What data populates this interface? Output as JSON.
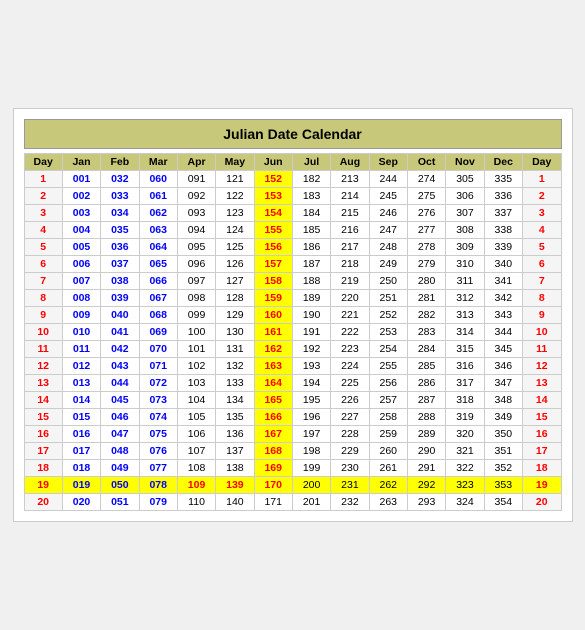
{
  "title": "Julian Date Calendar",
  "headers": [
    "Day",
    "Jan",
    "Feb",
    "Mar",
    "Apr",
    "May",
    "Jun",
    "Jul",
    "Aug",
    "Sep",
    "Oct",
    "Nov",
    "Dec",
    "Day"
  ],
  "rows": [
    {
      "day": 1,
      "vals": [
        "001",
        "032",
        "060",
        "091",
        "121",
        "152",
        "182",
        "213",
        "244",
        "274",
        "305",
        "335"
      ],
      "highlight_row": false,
      "jun_highlight": true
    },
    {
      "day": 2,
      "vals": [
        "002",
        "033",
        "061",
        "092",
        "122",
        "153",
        "183",
        "214",
        "245",
        "275",
        "306",
        "336"
      ],
      "highlight_row": false,
      "jun_highlight": true
    },
    {
      "day": 3,
      "vals": [
        "003",
        "034",
        "062",
        "093",
        "123",
        "154",
        "184",
        "215",
        "246",
        "276",
        "307",
        "337"
      ],
      "highlight_row": false,
      "jun_highlight": true
    },
    {
      "day": 4,
      "vals": [
        "004",
        "035",
        "063",
        "094",
        "124",
        "155",
        "185",
        "216",
        "247",
        "277",
        "308",
        "338"
      ],
      "highlight_row": false,
      "jun_highlight": true
    },
    {
      "day": 5,
      "vals": [
        "005",
        "036",
        "064",
        "095",
        "125",
        "156",
        "186",
        "217",
        "248",
        "278",
        "309",
        "339"
      ],
      "highlight_row": false,
      "jun_highlight": true
    },
    {
      "day": 6,
      "vals": [
        "006",
        "037",
        "065",
        "096",
        "126",
        "157",
        "187",
        "218",
        "249",
        "279",
        "310",
        "340"
      ],
      "highlight_row": false,
      "jun_highlight": true
    },
    {
      "day": 7,
      "vals": [
        "007",
        "038",
        "066",
        "097",
        "127",
        "158",
        "188",
        "219",
        "250",
        "280",
        "311",
        "341"
      ],
      "highlight_row": false,
      "jun_highlight": true
    },
    {
      "day": 8,
      "vals": [
        "008",
        "039",
        "067",
        "098",
        "128",
        "159",
        "189",
        "220",
        "251",
        "281",
        "312",
        "342"
      ],
      "highlight_row": false,
      "jun_highlight": true
    },
    {
      "day": 9,
      "vals": [
        "009",
        "040",
        "068",
        "099",
        "129",
        "160",
        "190",
        "221",
        "252",
        "282",
        "313",
        "343"
      ],
      "highlight_row": false,
      "jun_highlight": true
    },
    {
      "day": 10,
      "vals": [
        "010",
        "041",
        "069",
        "100",
        "130",
        "161",
        "191",
        "222",
        "253",
        "283",
        "314",
        "344"
      ],
      "highlight_row": false,
      "jun_highlight": true
    },
    {
      "day": 11,
      "vals": [
        "011",
        "042",
        "070",
        "101",
        "131",
        "162",
        "192",
        "223",
        "254",
        "284",
        "315",
        "345"
      ],
      "highlight_row": false,
      "jun_highlight": true
    },
    {
      "day": 12,
      "vals": [
        "012",
        "043",
        "071",
        "102",
        "132",
        "163",
        "193",
        "224",
        "255",
        "285",
        "316",
        "346"
      ],
      "highlight_row": false,
      "jun_highlight": true
    },
    {
      "day": 13,
      "vals": [
        "013",
        "044",
        "072",
        "103",
        "133",
        "164",
        "194",
        "225",
        "256",
        "286",
        "317",
        "347"
      ],
      "highlight_row": false,
      "jun_highlight": true
    },
    {
      "day": 14,
      "vals": [
        "014",
        "045",
        "073",
        "104",
        "134",
        "165",
        "195",
        "226",
        "257",
        "287",
        "318",
        "348"
      ],
      "highlight_row": false,
      "jun_highlight": true
    },
    {
      "day": 15,
      "vals": [
        "015",
        "046",
        "074",
        "105",
        "135",
        "166",
        "196",
        "227",
        "258",
        "288",
        "319",
        "349"
      ],
      "highlight_row": false,
      "jun_highlight": true
    },
    {
      "day": 16,
      "vals": [
        "016",
        "047",
        "075",
        "106",
        "136",
        "167",
        "197",
        "228",
        "259",
        "289",
        "320",
        "350"
      ],
      "highlight_row": false,
      "jun_highlight": true
    },
    {
      "day": 17,
      "vals": [
        "017",
        "048",
        "076",
        "107",
        "137",
        "168",
        "198",
        "229",
        "260",
        "290",
        "321",
        "351"
      ],
      "highlight_row": false,
      "jun_highlight": true
    },
    {
      "day": 18,
      "vals": [
        "018",
        "049",
        "077",
        "108",
        "138",
        "169",
        "199",
        "230",
        "261",
        "291",
        "322",
        "352"
      ],
      "highlight_row": false,
      "jun_highlight": true
    },
    {
      "day": 19,
      "vals": [
        "019",
        "050",
        "078",
        "109",
        "139",
        "170",
        "200",
        "231",
        "262",
        "292",
        "323",
        "353"
      ],
      "highlight_row": true,
      "jun_highlight": true
    },
    {
      "day": 20,
      "vals": [
        "020",
        "051",
        "079",
        "110",
        "140",
        "171",
        "201",
        "232",
        "263",
        "293",
        "324",
        "354"
      ],
      "highlight_row": false,
      "jun_highlight": false
    }
  ],
  "blue_cols": [
    0,
    1,
    2
  ],
  "special": {
    "row19_blue": [
      "Jan",
      "Feb",
      "Mar"
    ],
    "row19_red_col": "Apr",
    "row19_yellow_cols": [
      "May",
      "Jun"
    ]
  }
}
